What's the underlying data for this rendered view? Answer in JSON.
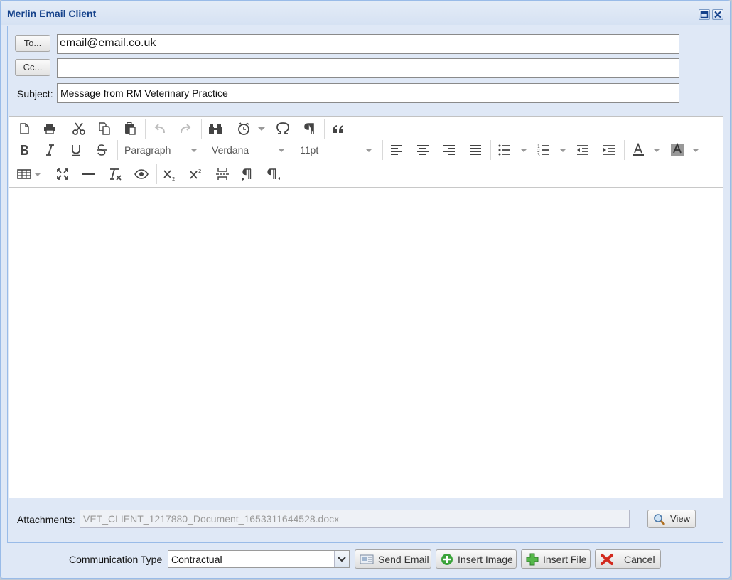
{
  "window": {
    "title": "Merlin Email Client"
  },
  "form": {
    "to_button": "To...",
    "cc_button": "Cc...",
    "to_value": "email@email.co.uk",
    "cc_value": "",
    "subject_label": "Subject:",
    "subject_value": "Message from RM Veterinary Practice"
  },
  "toolbar": {
    "format_block": "Paragraph",
    "font_family": "Verdana",
    "font_size": "11pt"
  },
  "attachments": {
    "label": "Attachments:",
    "value": "VET_CLIENT_1217880_Document_1653311644528.docx",
    "view_button": "View"
  },
  "footer": {
    "communication_type_label": "Communication Type",
    "communication_type_value": "Contractual",
    "send_button": "Send Email",
    "insert_image_button": "Insert Image",
    "insert_file_button": "Insert File",
    "cancel_button": "Cancel"
  },
  "colors": {
    "title": "#15428b",
    "panel_bg": "#dfe8f6",
    "panel_border": "#99bbe8",
    "icon": "#444444"
  },
  "icons": [
    "new-document-icon",
    "print-icon",
    "cut-icon",
    "copy-icon",
    "paste-icon",
    "undo-icon",
    "redo-icon",
    "find-icon",
    "alarm-clock-icon",
    "omega-icon",
    "pilcrow-icon",
    "blockquote-icon",
    "bold-icon",
    "italic-icon",
    "underline-icon",
    "strikethrough-icon",
    "align-left-icon",
    "align-center-icon",
    "align-right-icon",
    "justify-icon",
    "bullet-list-icon",
    "numbered-list-icon",
    "outdent-icon",
    "indent-icon",
    "text-color-icon",
    "background-color-icon",
    "table-icon",
    "fullscreen-icon",
    "horizontal-rule-icon",
    "clear-formatting-icon",
    "preview-icon",
    "subscript-icon",
    "superscript-icon",
    "page-break-icon",
    "ltr-icon",
    "rtl-icon",
    "magnifier-icon",
    "send-email-icon",
    "insert-image-icon",
    "insert-file-icon",
    "cancel-icon"
  ]
}
